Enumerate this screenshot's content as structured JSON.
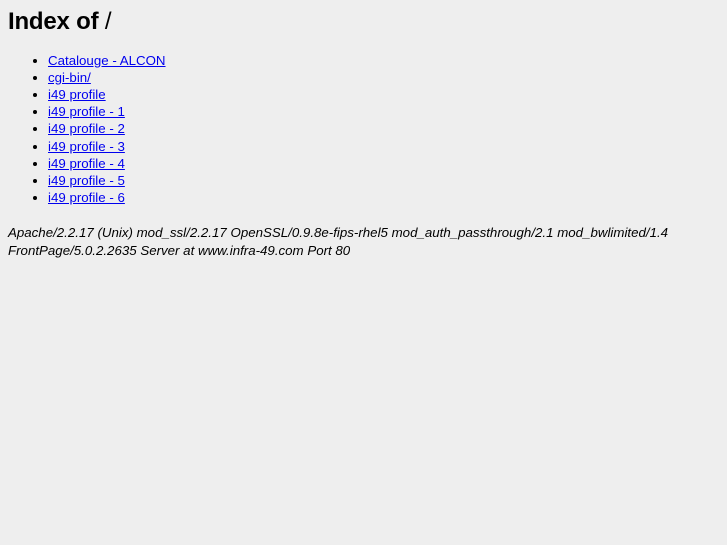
{
  "page": {
    "title_prefix": "Index of",
    "title_path": "/",
    "background_color": "#eeeeee",
    "link_color": "#0000ee",
    "text_color": "#000000"
  },
  "index_list": [
    {
      "label": "Catalouge - ALCON"
    },
    {
      "label": "cgi-bin/"
    },
    {
      "label": "i49 profile"
    },
    {
      "label": "i49 profile - 1"
    },
    {
      "label": "i49 profile - 2"
    },
    {
      "label": "i49 profile - 3"
    },
    {
      "label": "i49 profile - 4"
    },
    {
      "label": "i49 profile - 5"
    },
    {
      "label": "i49 profile - 6"
    }
  ],
  "server_signature": {
    "line1": "Apache/2.2.17 (Unix) mod_ssl/2.2.17 OpenSSL/0.9.8e-fips-rhel5 mod_auth_passthrough/2.1 mod_bwlimited/1.4",
    "line2": "FrontPage/5.0.2.2635 Server at www.infra-49.com Port 80"
  }
}
